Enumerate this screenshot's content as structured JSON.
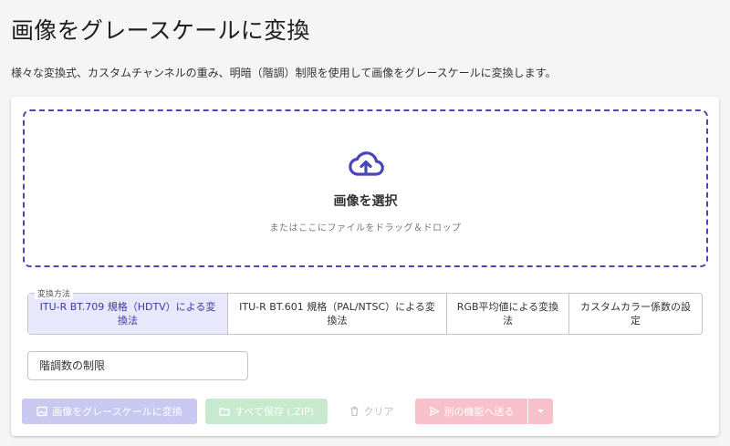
{
  "header": {
    "title": "画像をグレースケールに変換",
    "description": "様々な変換式、カスタムチャンネルの重み、明暗（階調）制限を使用して画像をグレースケールに変換します。"
  },
  "dropzone": {
    "icon": "cloud-upload-icon",
    "title": "画像を選択",
    "subtitle": "またはここにファイルをドラッグ＆ドロップ",
    "accent_color": "#4b46b8"
  },
  "method": {
    "legend": "変換方法",
    "options": [
      {
        "label": "ITU-R BT.709 規格（HDTV）による変換法",
        "selected": true
      },
      {
        "label": "ITU-R BT.601 規格（PAL/NTSC）による変換法",
        "selected": false
      },
      {
        "label": "RGB平均値による変換法",
        "selected": false
      },
      {
        "label": "カスタムカラー係数の設定",
        "selected": false
      }
    ]
  },
  "bits_field": {
    "value": "階調数の制限"
  },
  "actions": {
    "convert_label": "画像をグレースケールに変換",
    "convert_icon": "image-icon",
    "zip_label": "すべて保存 (.ZIP)",
    "zip_icon": "folder-icon",
    "clear_label": "クリア",
    "clear_icon": "trash-icon",
    "send_label": "別の機能へ送る",
    "send_icon": "send-icon",
    "dropdown_icon": "caret-down-icon"
  },
  "colors": {
    "primary": "#4b46b8",
    "selected_bg": "#e8e7fb",
    "convert_disabled": "#c9c8f1",
    "zip_disabled": "#c7e9cd",
    "send_disabled": "#f8c0cb"
  }
}
